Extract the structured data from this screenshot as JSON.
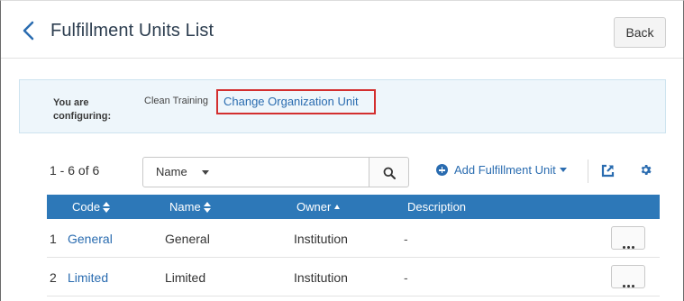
{
  "header": {
    "title": "Fulfillment Units List",
    "back_button": "Back"
  },
  "config": {
    "label": "You are configuring:",
    "org": "Clean Training",
    "change_link": "Change Organization Unit"
  },
  "toolbar": {
    "result_count": "1 - 6 of 6",
    "search_field_selected": "Name",
    "search_value": "",
    "add_label": "Add Fulfillment Unit",
    "icons": [
      "search-icon",
      "add-circle-icon",
      "export-icon",
      "gear-icon"
    ]
  },
  "table": {
    "columns": [
      "Code",
      "Name",
      "Owner",
      "Description"
    ],
    "rows": [
      {
        "num": "1",
        "code": "General",
        "name": "General",
        "owner": "Institution",
        "description": "-"
      },
      {
        "num": "2",
        "code": "Limited",
        "name": "Limited",
        "owner": "Institution",
        "description": "-"
      }
    ]
  },
  "colors": {
    "accent": "#2a6cb0",
    "table_header": "#2d78b8",
    "highlight_border": "#d32f2f",
    "config_bg": "#eef6fb"
  }
}
